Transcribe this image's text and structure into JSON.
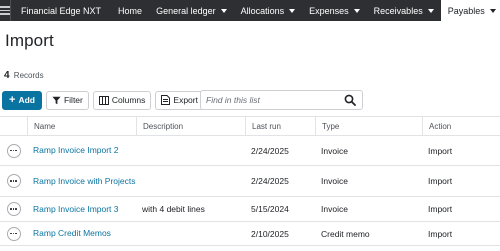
{
  "nav": {
    "brand": "Financial Edge NXT",
    "items": [
      {
        "label": "Home",
        "dropdown": false,
        "active": false
      },
      {
        "label": "General ledger",
        "dropdown": true,
        "active": false
      },
      {
        "label": "Allocations",
        "dropdown": true,
        "active": false
      },
      {
        "label": "Expenses",
        "dropdown": true,
        "active": false
      },
      {
        "label": "Receivables",
        "dropdown": true,
        "active": false
      },
      {
        "label": "Payables",
        "dropdown": true,
        "active": true
      }
    ]
  },
  "page": {
    "title": "Import",
    "record_count": "4",
    "records_label": "Records"
  },
  "toolbar": {
    "add_label": "Add",
    "filter_label": "Filter",
    "columns_label": "Columns",
    "export_label": "Export",
    "search_placeholder": "Find in this list"
  },
  "table": {
    "columns": [
      "",
      "Name",
      "Description",
      "Last run",
      "Type",
      "Action"
    ],
    "rows": [
      {
        "name": "Ramp Invoice Import 2",
        "description": "",
        "last_run": "2/24/2025",
        "type": "Invoice",
        "action": "Import"
      },
      {
        "name": "Ramp Invoice with Projects",
        "description": "",
        "last_run": "2/24/2025",
        "type": "Invoice",
        "action": "Import"
      },
      {
        "name": "Ramp Invoice Import 3",
        "description": "with 4 debit lines",
        "last_run": "5/15/2024",
        "type": "Invoice",
        "action": "Import"
      },
      {
        "name": "Ramp Credit Memos",
        "description": "",
        "last_run": "2/10/2025",
        "type": "Credit memo",
        "action": "Import"
      }
    ]
  },
  "colors": {
    "nav_bg": "#2d2f33",
    "primary": "#0974a1",
    "link": "#0974a1"
  }
}
